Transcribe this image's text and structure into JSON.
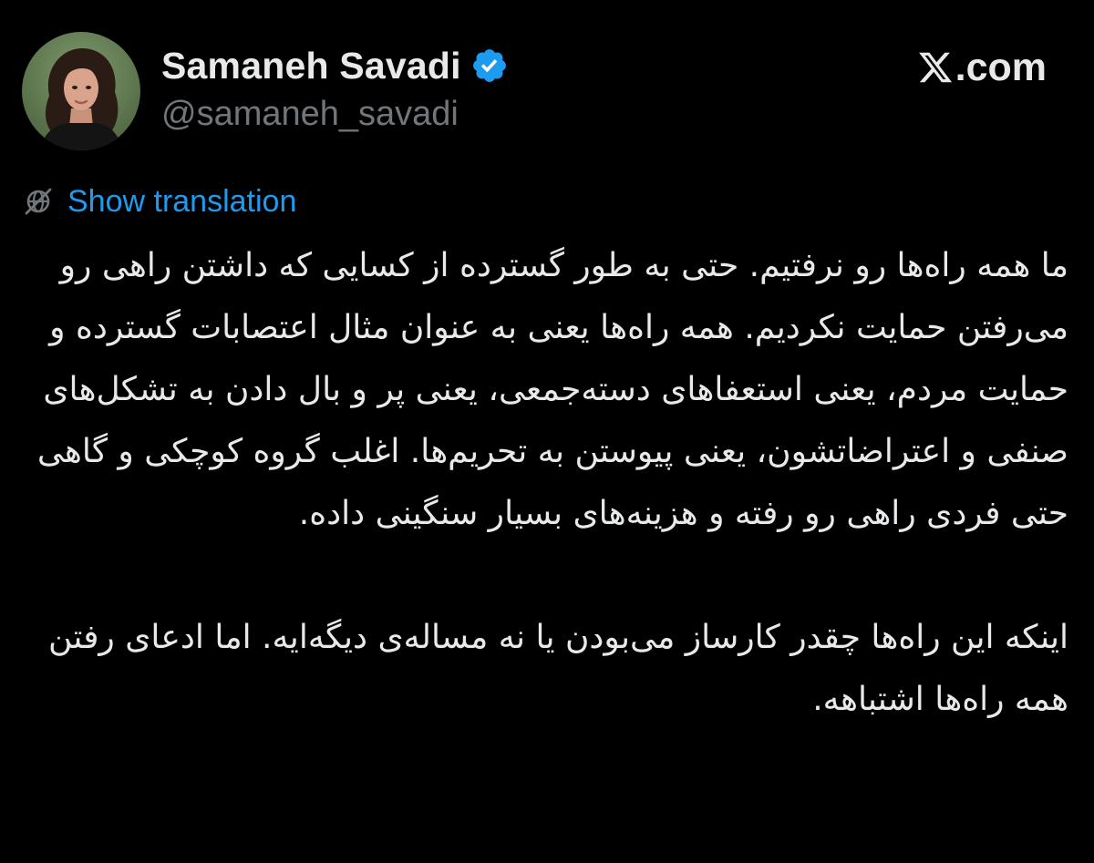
{
  "author": {
    "display_name": "Samaneh Savadi",
    "handle": "@samaneh_savadi",
    "verified": true,
    "avatar_icon": "profile-photo"
  },
  "brand": {
    "text": ".com",
    "logo_icon": "x-logo-icon"
  },
  "translation": {
    "icon": "globe-icon",
    "label": "Show translation"
  },
  "tweet": {
    "paragraphs": [
      "ما همه راه‌ها رو نرفتیم. حتی به طور گسترده از کسایی که داشتن راهی رو می‌رفتن حمایت نکردیم. همه راه‌ها یعنی به عنوان مثال اعتصابات گسترده و حمایت مردم، یعنی استعفاهای دسته‌جمعی، یعنی پر و بال دادن به تشکل‌های صنفی و اعتراضاتشون، یعنی پیوستن به تحریم‌ها. اغلب گروه کوچکی و گاهی حتی فردی راهی رو رفته و هزینه‌های بسیار سنگینی داده.",
      "اینکه این راه‌ها چقدر کارساز می‌بودن یا نه مساله‌ی دیگه‌ایه. اما ادعای رفتن همه راه‌ها اشتباهه."
    ]
  },
  "colors": {
    "background": "#000000",
    "text_primary": "#e7e9ea",
    "text_secondary": "#71767b",
    "link": "#1d9bf0",
    "verified_badge": "#1d9bf0"
  }
}
